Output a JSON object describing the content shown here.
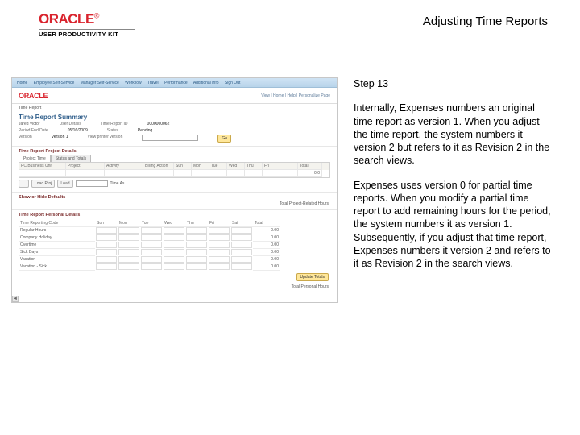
{
  "header": {
    "brand": "ORACLE",
    "reg": "®",
    "sub": "USER PRODUCTIVITY KIT",
    "title": "Adjusting Time Reports"
  },
  "step": {
    "label": "Step 13"
  },
  "body": {
    "p1": "Internally, Expenses numbers an original time report as version 1. When you adjust the time report, the system numbers it version 2 but refers to it as Revision 2 in the search views.",
    "p2": "Expenses uses version 0 for partial time reports. When you modify a partial time report to add remaining hours for the period, the system numbers it as version 1. Subsequently, if you adjust that time report, Expenses numbers it version 2 and refers to it as Revision 2 in the search views."
  },
  "app": {
    "nav": [
      "Home",
      "Employee Self-Service",
      "Manager Self-Service",
      "Workflow",
      "Travel",
      "Performance",
      "Additional Info",
      "Sign Out"
    ],
    "links": "View | Home | Help | Personalize Page",
    "crumb": "Time Report",
    "summary_title": "Time Report Summary",
    "user_label": "User Details",
    "user": "Jared Victor",
    "date_label": "Period End Date",
    "date": "05/16/2009",
    "id_label": "Time Report ID",
    "id": "0000000062",
    "status_label": "Status",
    "status": "Pending",
    "version_label": "Version",
    "version": "Version 1",
    "view_label": "View printer version",
    "go": "Go",
    "sect1": "Time Report Project Details",
    "tabs": [
      "Project Time",
      "Status and Totals"
    ],
    "grid_head": [
      "PC Business Unit",
      "Project",
      "Activity",
      "Billing Action",
      "Sun",
      "Mon",
      "Tue",
      "Wed",
      "Thu",
      "Fri",
      "Total"
    ],
    "grid_row1": [
      "",
      "",
      "",
      "",
      "",
      "",
      "",
      "",
      "",
      "",
      "0.0"
    ],
    "toolbar": {
      "b1": "…",
      "b2": "Load Proj",
      "b3": "Load",
      "sel": "Time As"
    },
    "sect2": "Show or Hide Defaults",
    "right_note": "Total Project-Related Hours",
    "sect3": "Time Report Personal Details",
    "grid2_head": [
      "Time Reporting Code",
      "Sun",
      "Mon",
      "Tue",
      "Wed",
      "Thu",
      "Fri",
      "Sat",
      "Total"
    ],
    "grid2_rows": [
      {
        "code": "Regular Hours",
        "tot": "0.00"
      },
      {
        "code": "Company Holiday",
        "tot": "0.00"
      },
      {
        "code": "Overtime",
        "tot": "0.00"
      },
      {
        "code": "Sick Days",
        "tot": "0.00"
      },
      {
        "code": "Vacation",
        "tot": "0.00"
      },
      {
        "code": "Vacation - Sick",
        "tot": "0.00"
      }
    ],
    "update": "Update Totals",
    "total_label": "Total Personal Hours"
  }
}
